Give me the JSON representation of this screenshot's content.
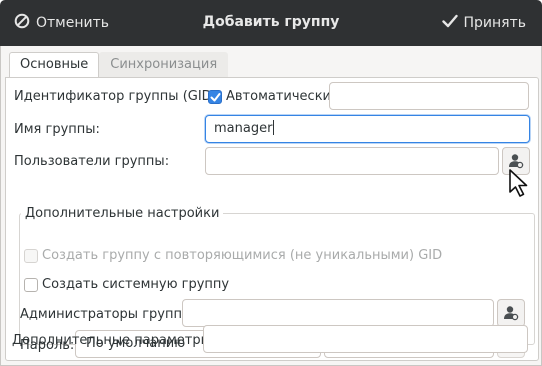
{
  "window": {
    "title": "Добавить группу",
    "cancel_label": "Отменить",
    "accept_label": "Принять",
    "cancel_icon": "cancel-circle-icon",
    "accept_icon": "checkmark-icon"
  },
  "tabs": [
    {
      "label": "Основные",
      "active": true
    },
    {
      "label": "Синхронизация",
      "active": false
    }
  ],
  "form": {
    "gid_label": "Идентификатор группы (GID):",
    "gid_auto_label": "Автоматически",
    "gid_auto_checked": true,
    "gid_value": "",
    "name_label": "Имя группы:",
    "name_value": "manager",
    "users_label": "Пользователи группы:",
    "users_value": "",
    "users_icon": "select-users-icon",
    "advanced_title": "Дополнительные настройки",
    "nonunique_label": "Создать группу с повторяющимися (не уникальными) GID",
    "nonunique_checked": false,
    "nonunique_disabled": true,
    "system_label": "Создать системную группу",
    "system_checked": false,
    "admins_label": "Администраторы группы:",
    "admins_value": "",
    "admins_icon": "select-users-icon",
    "password_label": "Пароль:",
    "password_option": "По умолчанию",
    "password_value": "********",
    "password_edit_icon": "pencil-icon",
    "extra_label": "Дополнительные параметры:",
    "extra_value": ""
  },
  "colors": {
    "titlebar": "#2f3133",
    "accent": "#3584e4"
  }
}
